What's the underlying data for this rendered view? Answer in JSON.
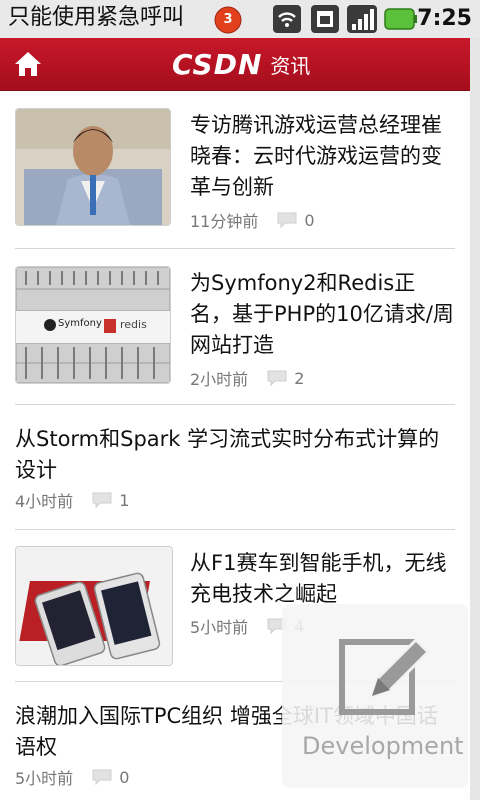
{
  "statusbar": {
    "ticker": "只能使用紧急呼叫",
    "notification_count": "3",
    "time": "7:25"
  },
  "header": {
    "logo": "CSDN",
    "section": "资讯"
  },
  "articles": [
    {
      "title": "专访腾讯游戏运营总经理崔晓春：云时代游戏运营的变革与创新",
      "time": "11分钟前",
      "comments": "0"
    },
    {
      "title": "为Symfony2和Redis正名，基于PHP的10亿请求/周网站打造",
      "time": "2小时前",
      "comments": "2",
      "thumb_labels": [
        "Symfony",
        "redis"
      ]
    },
    {
      "title": "从Storm和Spark 学习流式实时分布式计算的设计",
      "time": "4小时前",
      "comments": "1"
    },
    {
      "title": "从F1赛车到智能手机，无线充电技术之崛起",
      "time": "5小时前",
      "comments": "4"
    },
    {
      "title": "浪潮加入国际TPC组织 增强全球IT领域中国话语权",
      "time": "5小时前",
      "comments": "0"
    }
  ],
  "overlay": {
    "label": "Development"
  }
}
